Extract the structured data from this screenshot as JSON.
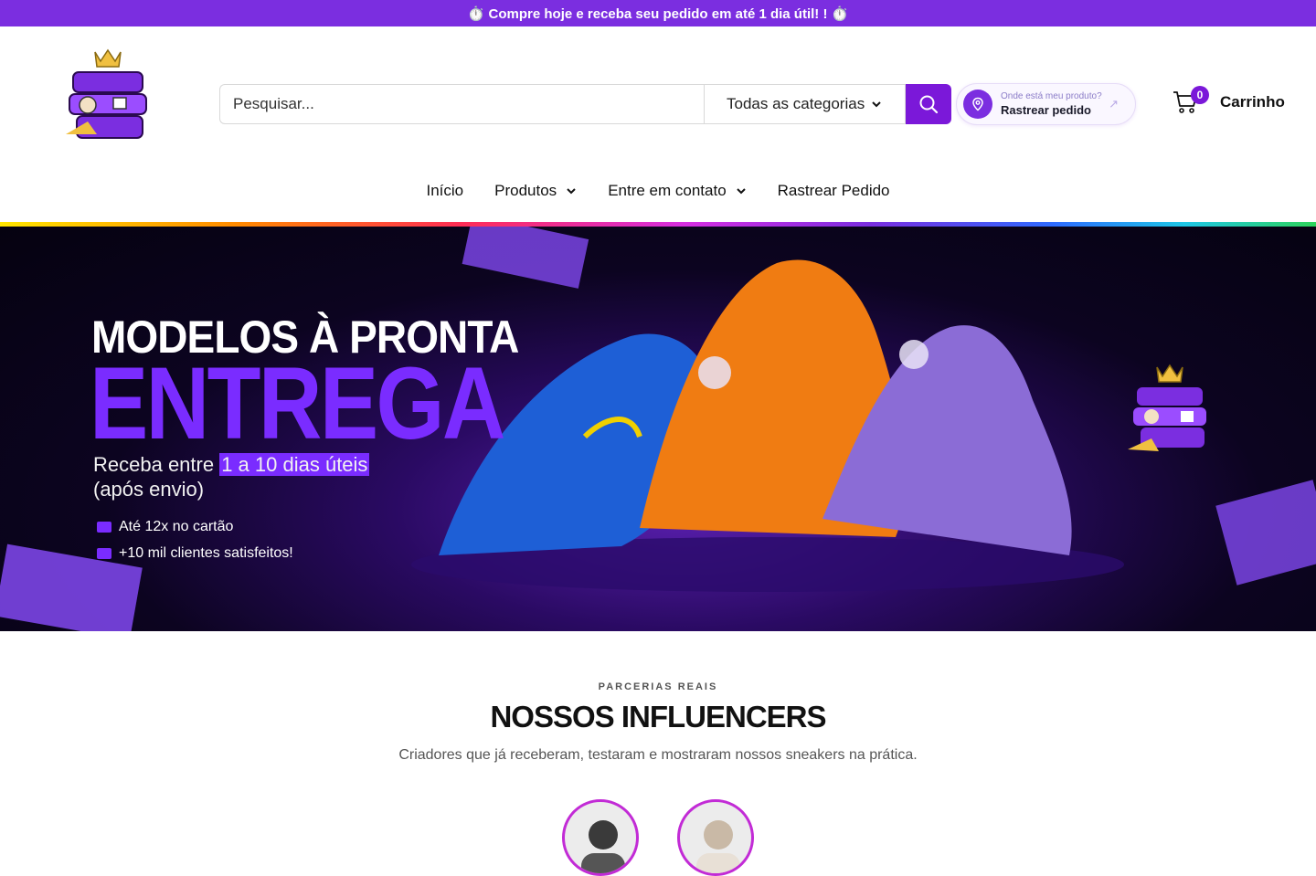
{
  "announcement": {
    "text": "⏱️ Compre hoje e receba seu pedido em até 1 dia útil! ! ⏱️"
  },
  "header": {
    "logo_icon": "crown-graffiti-logo",
    "search": {
      "placeholder": "Pesquisar...",
      "value": "",
      "category_label": "Todas as categorias",
      "button_icon": "search-icon"
    },
    "track_order": {
      "small_text": "Onde está meu produto?",
      "main_text": "Rastrear pedido",
      "icon": "location-pin-icon"
    },
    "cart": {
      "count": "0",
      "label": "Carrinho",
      "icon": "cart-icon"
    }
  },
  "nav": {
    "items": [
      {
        "label": "Início"
      },
      {
        "label": "Produtos"
      },
      {
        "label": "Entre em contato"
      },
      {
        "label": "Rastrear Pedido"
      }
    ]
  },
  "hero": {
    "title_line1": "MODELOS À PRONTA",
    "title_line2": "ENTREGA",
    "subtitle_prefix": "Receba entre ",
    "subtitle_highlight": "1 a 10 dias úteis",
    "subtitle_line2": "(após envio)",
    "bullet1": "Até 12x no cartão",
    "bullet2": "+10 mil clientes satisfeitos!",
    "image_desc": "three sneakers blue orange purple"
  },
  "influencers": {
    "eyebrow": "PARCERIAS REAIS",
    "title": "NOSSOS INFLUENCERS",
    "subtitle": "Criadores que já receberam, testaram e mostraram nossos sneakers na prática."
  },
  "colors": {
    "accent": "#7b2ee0",
    "brand_purple": "#7a2cff"
  }
}
